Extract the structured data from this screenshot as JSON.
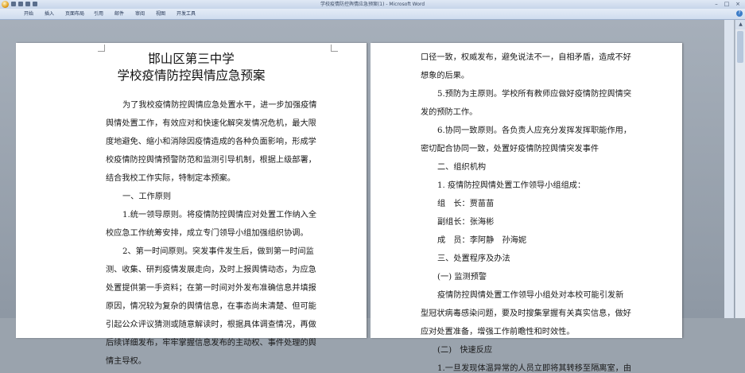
{
  "window": {
    "title": "学校疫情防控舆情应急预案(1) - Microsoft Word",
    "controls": [
      "–",
      "□",
      "×"
    ]
  },
  "ribbon": {
    "tabs": [
      "开始",
      "插入",
      "页面布局",
      "引用",
      "邮件",
      "审阅",
      "视图",
      "开发工具"
    ]
  },
  "page1": {
    "title_line1": "邯山区第三中学",
    "title_line2": "学校疫情防控舆情应急预案",
    "lines": [
      "为了我校疫情防控舆情应急处置水平，进一步加强疫情",
      "舆情处置工作，有效应对和快速化解突发情况危机，最大限",
      "度地避免、缩小和消除因疫情造成的各种负面影响，形成学",
      "校疫情防控舆情预警防范和监测引导机制，根据上级部署，",
      "结合我校工作实际，特制定本预案。",
      "一、工作原则",
      "1.统一领导原则。将疫情防控舆情应对处置工作纳入全",
      "校应急工作统筹安排，成立专门领导小组加强组织协调。",
      "2、第一时间原则。突发事件发生后，做到第一时间监",
      "测、收集、研判疫情发展走向，及时上报舆情动态，为应急",
      "处置提供第一手资料；在第一时间对外发布准确信息并填报",
      "原因，情况较为复杂的舆情信息，在事态尚未清楚、但可能",
      "引起公众评议猜测或随意解读时，根据具体调查情况，再做",
      "后续详细发布，牢牢掌握信息发布的主动权、事件处理的舆",
      "情主导权。"
    ]
  },
  "page2": {
    "lines": [
      "口径一致，权威发布，避免说法不一，自相矛盾，造成不好",
      "想象的后果。",
      "5.预防为主原则。学校所有教师应做好疫情防控舆情突",
      "发的预防工作。",
      "6.协同一致原则。各负责人应充分发挥发挥职能作用，",
      "密切配合协同一致，处置好疫情防控舆情突发事件",
      "二、组织机构",
      "1. 疫情防控舆情处置工作领导小组组成：",
      "组　长：贾苗苗",
      "副组长：张海彬",
      "成　员：李阿静　孙海妮",
      "三、处置程序及办法",
      "(一) 监测预警",
      "疫情防控舆情处置工作领导小组处对本校可能引发新",
      "型冠状病毒感染问题，要及时搜集掌握有关真实信息，做好",
      "应对处置准备，增强工作前瞻性和时效性。",
      "(二)　快速反应",
      "1.一旦发现体温异常的人员立即将其转移至隔离室，由"
    ]
  },
  "scrollbar": {
    "up_arrow": "▲"
  }
}
